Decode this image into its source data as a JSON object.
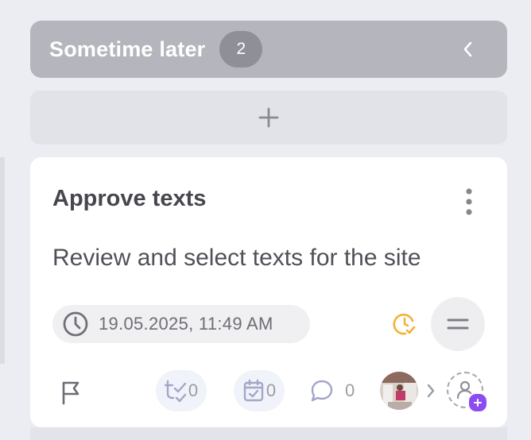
{
  "column": {
    "title": "Sometime later",
    "count": "2",
    "collapse_icon": "chevron-left-icon"
  },
  "add_task": {
    "icon": "plus-icon"
  },
  "card": {
    "title": "Approve texts",
    "description": "Review and select texts for the site",
    "due_date": "19.05.2025, 11:49 AM",
    "subtasks_count": "0",
    "checklist_count": "0",
    "comments_count": "0",
    "colors": {
      "status_clock": "#f2b233",
      "assignee_badge": "#8b4df2"
    }
  }
}
